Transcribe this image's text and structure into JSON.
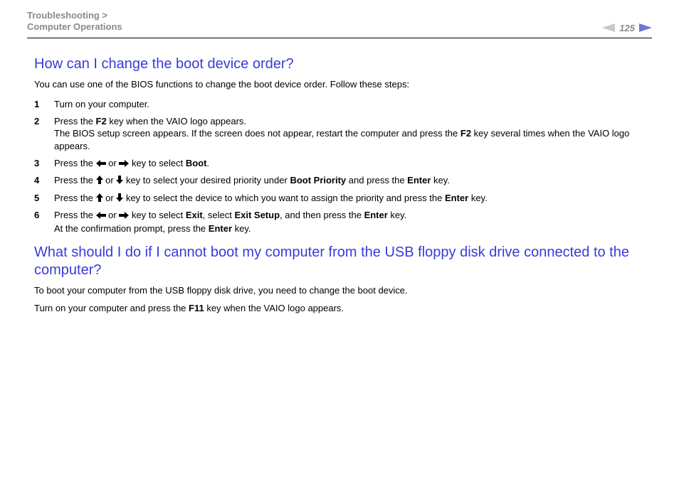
{
  "header": {
    "breadcrumb_line1": "Troubleshooting >",
    "breadcrumb_line2": "Computer Operations",
    "page_number": "125"
  },
  "section1": {
    "heading": "How can I change the boot device order?",
    "intro": "You can use one of the BIOS functions to change the boot device order. Follow these steps:",
    "steps": {
      "s1": "Turn on your computer.",
      "s2a": "Press the ",
      "s2b": "F2",
      "s2c": " key when the VAIO logo appears.",
      "s2d": "The BIOS setup screen appears. If the screen does not appear, restart the computer and press the ",
      "s2e": "F2",
      "s2f": " key several times when the VAIO logo appears.",
      "s3a": "Press the ",
      "s3b": " or ",
      "s3c": " key to select ",
      "s3d": "Boot",
      "s3e": ".",
      "s4a": "Press the ",
      "s4b": " or ",
      "s4c": " key to select your desired priority under ",
      "s4d": "Boot Priority",
      "s4e": " and press the ",
      "s4f": "Enter",
      "s4g": " key.",
      "s5a": "Press the ",
      "s5b": " or ",
      "s5c": " key to select the device to which you want to assign the priority and press the ",
      "s5d": "Enter",
      "s5e": " key.",
      "s6a": "Press the ",
      "s6b": " or ",
      "s6c": " key to select ",
      "s6d": "Exit",
      "s6e": ", select ",
      "s6f": "Exit Setup",
      "s6g": ", and then press the ",
      "s6h": "Enter",
      "s6i": " key.",
      "s6j": "At the confirmation prompt, press the ",
      "s6k": "Enter",
      "s6l": " key."
    }
  },
  "section2": {
    "heading": "What should I do if I cannot boot my computer from the USB floppy disk drive connected to the computer?",
    "p1": "To boot your computer from the USB floppy disk drive, you need to change the boot device.",
    "p2a": "Turn on your computer and press the ",
    "p2b": "F11",
    "p2c": " key when the VAIO logo appears."
  }
}
